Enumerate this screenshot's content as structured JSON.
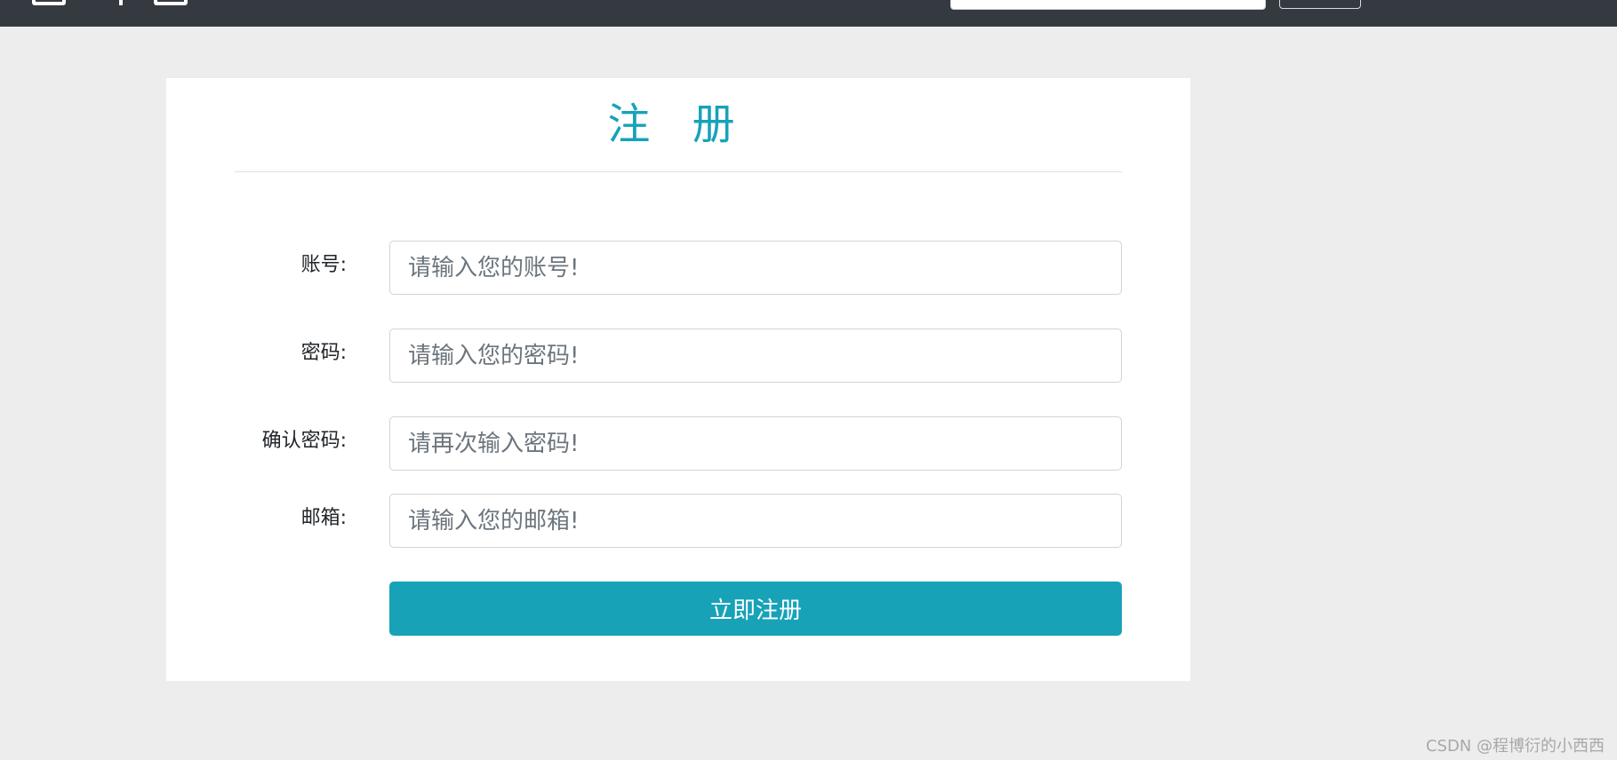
{
  "navbar": {
    "icons": [
      "square-icon",
      "plus-icon",
      "square-icon"
    ],
    "search": {
      "value": "",
      "placeholder": ""
    },
    "search_button_label": ""
  },
  "form": {
    "title": "注 册",
    "fields": [
      {
        "label": "账号:",
        "placeholder": "请输入您的账号!",
        "value": ""
      },
      {
        "label": "密码:",
        "placeholder": "请输入您的密码!",
        "value": ""
      },
      {
        "label": "确认密码:",
        "placeholder": "请再次输入密码!",
        "value": ""
      },
      {
        "label": "邮箱:",
        "placeholder": "请输入您的邮箱!",
        "value": ""
      }
    ],
    "submit_label": "立即注册"
  },
  "watermark": "CSDN @程博衍的小西西",
  "colors": {
    "navbar_bg": "#343a40",
    "page_bg": "#ededed",
    "accent": "#17a2b8",
    "card_bg": "#ffffff"
  }
}
